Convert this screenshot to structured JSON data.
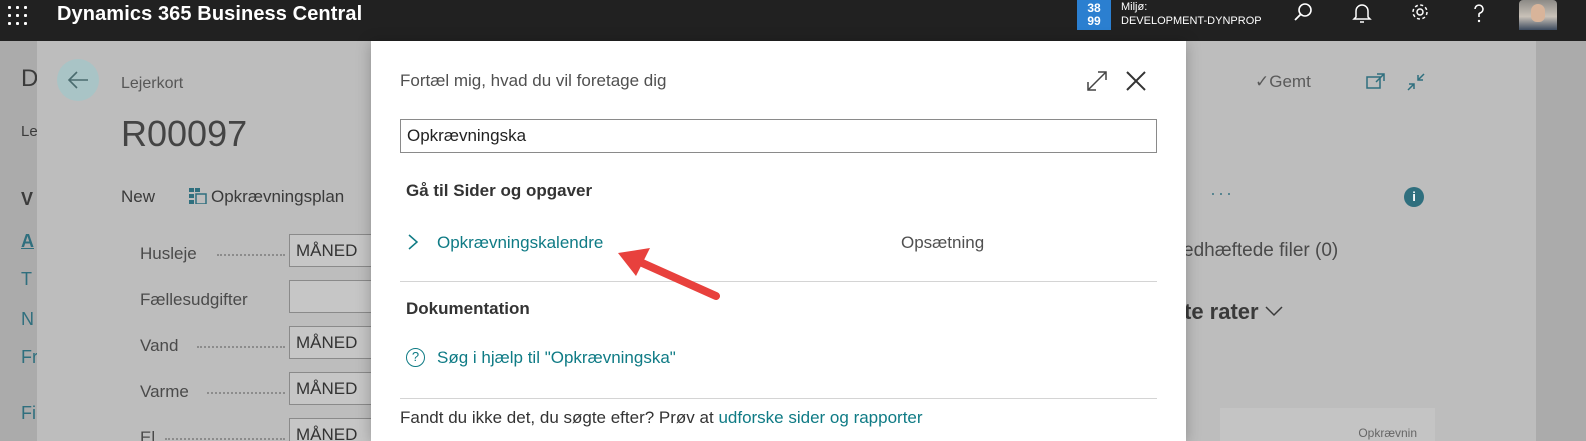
{
  "topbar": {
    "app_title": "Dynamics 365 Business Central",
    "env_badge": "38\n99",
    "env_label": "Miljø:",
    "env_name": "DEVELOPMENT-DYNPROP",
    "icons": [
      "waffle-icon",
      "search-icon",
      "bell-icon",
      "gear-icon",
      "help-icon",
      "avatar"
    ]
  },
  "background": {
    "outer_letters": [
      "D",
      "Le",
      "V",
      "A",
      "T",
      "N",
      "Fr",
      "Fi"
    ],
    "card_type": "Lejerkort",
    "card_title": "R00097",
    "saved_label": "Gemt",
    "commands": {
      "new": "New",
      "plan": "Opkrævningsplan",
      "more": "···"
    },
    "fields": [
      {
        "label": "Husleje",
        "value": "MÅNED"
      },
      {
        "label": "Fællesudgifter",
        "value": ""
      },
      {
        "label": "Vand",
        "value": "MÅNED"
      },
      {
        "label": "Varme",
        "value": "MÅNED"
      },
      {
        "label": "El",
        "value": "MÅNED"
      }
    ],
    "attachments": "edhæftede filer (0)",
    "rates_heading": "te rater",
    "bottom_box": "Opkrævnin"
  },
  "dialog": {
    "title": "Fortæl mig, hvad du vil foretage dig",
    "search_value": "Opkrævningska",
    "section_pages": "Gå til Sider og opgaver",
    "results": [
      {
        "name": "Opkrævningskalendre",
        "category": "Opsætning"
      }
    ],
    "section_docs": "Dokumentation",
    "help_link": "Søg i hjælp til \"Opkrævningska\"",
    "footer_prefix": "Fandt du ikke det, du søgte efter? Prøv at ",
    "footer_link": "udforske sider og rapporter"
  },
  "colors": {
    "topbar": "#212121",
    "accent": "#0f7b85",
    "env_badge": "#2b7fd0",
    "annotation_arrow": "#e8413d"
  }
}
